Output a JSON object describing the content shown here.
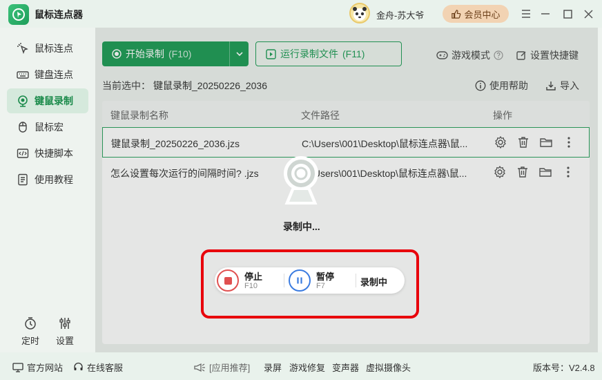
{
  "app": {
    "title": "鼠标连点器"
  },
  "user": {
    "name": "金舟-苏大爷"
  },
  "header": {
    "vip_label": "会员中心"
  },
  "sidebar": {
    "items": [
      {
        "label": "鼠标连点",
        "icon": "cursor-click-icon"
      },
      {
        "label": "键盘连点",
        "icon": "keyboard-icon"
      },
      {
        "label": "键鼠录制",
        "icon": "record-icon",
        "active": true
      },
      {
        "label": "鼠标宏",
        "icon": "mouse-icon"
      },
      {
        "label": "快捷脚本",
        "icon": "script-icon"
      },
      {
        "label": "使用教程",
        "icon": "tutorial-icon"
      }
    ],
    "bottom": [
      {
        "label": "定时",
        "icon": "timer-icon"
      },
      {
        "label": "设置",
        "icon": "settings-sliders-icon"
      }
    ]
  },
  "toolbar": {
    "start_label": "开始录制",
    "start_key": "(F10)",
    "run_label": "运行录制文件",
    "run_key": "(F11)",
    "game_mode_label": "游戏模式",
    "hotkey_label": "设置快捷键"
  },
  "selection": {
    "label": "当前选中：",
    "value": "键鼠录制_20250226_2036",
    "help_label": "使用帮助",
    "import_label": "导入"
  },
  "table": {
    "columns": [
      "键鼠录制名称",
      "文件路径",
      "操作"
    ],
    "rows": [
      {
        "name": "键鼠录制_20250226_2036.jzs",
        "path": "C:\\Users\\001\\Desktop\\鼠标连点器\\鼠...",
        "selected": true
      },
      {
        "name": "怎么设置每次运行的间隔时间? .jzs",
        "path": "C:\\Users\\001\\Desktop\\鼠标连点器\\鼠...",
        "selected": false
      }
    ]
  },
  "recording": {
    "status": "录制中...",
    "stop_label": "停止",
    "stop_key": "F10",
    "pause_label": "暂停",
    "pause_key": "F7",
    "state_label": "录制中"
  },
  "footer": {
    "website": "官方网站",
    "support": "在线客服",
    "recommend": "[应用推荐]",
    "links": [
      "录屏",
      "游戏修复",
      "变声器",
      "虚拟摄像头"
    ],
    "version": "版本号：V2.4.8"
  },
  "colors": {
    "accent": "#1f9d57",
    "highlight_frame": "#e8000b",
    "stop": "#e05050",
    "pause": "#3a7be0"
  }
}
